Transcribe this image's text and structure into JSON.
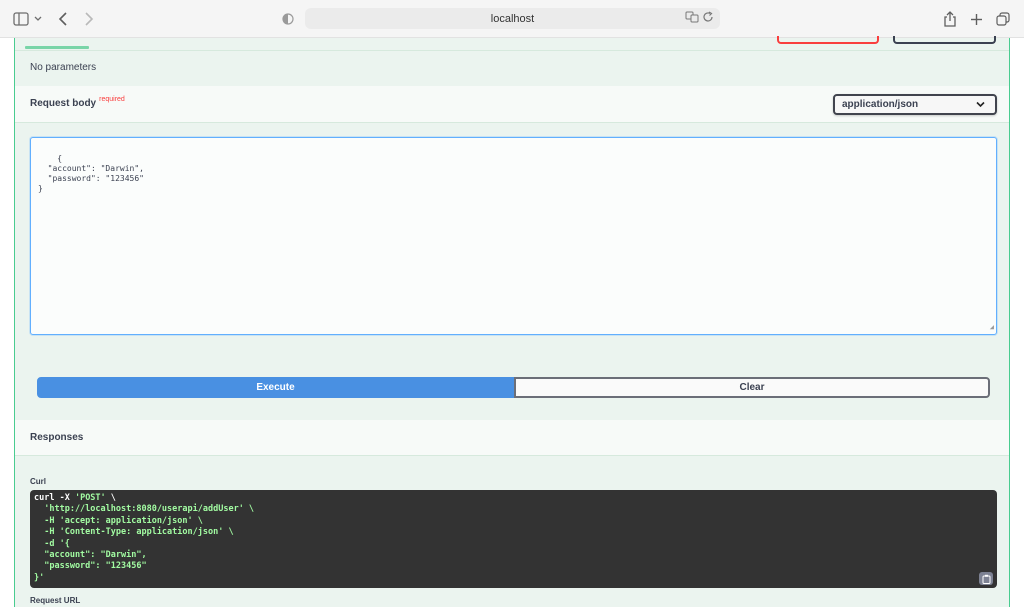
{
  "browser": {
    "url": "localhost",
    "icons": [
      "sidebar-icon",
      "chevron-down-icon",
      "back-icon",
      "forward-icon",
      "privacy-shield-icon",
      "translate-icon",
      "reload-icon",
      "share-icon",
      "new-tab-icon",
      "tabs-overview-icon"
    ]
  },
  "operation": {
    "parameters_text": "No parameters",
    "request_body": {
      "title": "Request body",
      "required_label": "required",
      "content_type": "application/json",
      "body_text": "{\n  \"account\": \"Darwin\",\n  \"password\": \"123456\"\n}"
    },
    "buttons": {
      "execute": "Execute",
      "clear": "Clear"
    },
    "responses": {
      "title": "Responses",
      "curl_label": "Curl",
      "curl_lines": [
        "curl -X 'POST' \\",
        "  'http://localhost:8080/userapi/addUser' \\",
        "  -H 'accept: application/json' \\",
        "  -H 'Content-Type: application/json' \\",
        "  -d '{",
        "  \"account\": \"Darwin\",",
        "  \"password\": \"123456\"",
        "}'"
      ],
      "request_url_label": "Request URL"
    }
  },
  "colors": {
    "accent_green": "#49cc90",
    "execute_blue": "#4990e2",
    "required_red": "#f93e3e",
    "code_bg": "#333333"
  }
}
